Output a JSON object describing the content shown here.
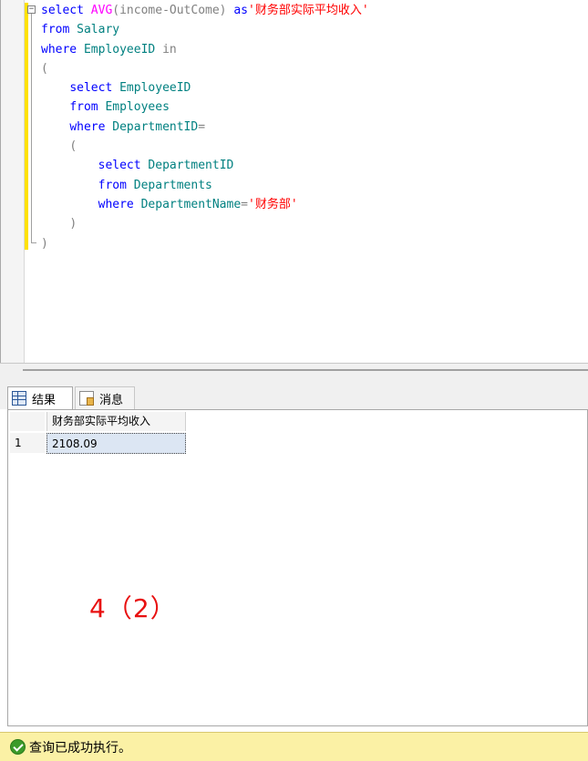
{
  "editor": {
    "line1": {
      "kw_select": "select",
      "fn_avg": "AVG",
      "args": "(income-OutCome)",
      "kw_as": "as",
      "alias": "'财务部实际平均收入'"
    },
    "line2": {
      "kw": "from",
      "ident": "Salary"
    },
    "line3": {
      "kw": "where",
      "ident": "EmployeeID",
      "kw_in": "in"
    },
    "line4": {
      "paren": "("
    },
    "line5": {
      "kw": "select",
      "ident": "EmployeeID"
    },
    "line6": {
      "kw": "from",
      "ident": "Employees"
    },
    "line7": {
      "kw": "where",
      "ident": "DepartmentID",
      "op": "="
    },
    "line8": {
      "paren": "("
    },
    "line9": {
      "kw": "select",
      "ident": "DepartmentID"
    },
    "line10": {
      "kw": "from",
      "ident": "Departments"
    },
    "line11": {
      "kw": "where",
      "ident": "DepartmentName",
      "op": "=",
      "str": "'财务部'"
    },
    "line12": {
      "paren": ")"
    },
    "line13": {
      "paren": ")"
    }
  },
  "tabs": {
    "results": "结果",
    "messages": "消息"
  },
  "grid": {
    "columns": [
      "财务部实际平均收入"
    ],
    "rows": [
      {
        "num": "1",
        "values": [
          "2108.09"
        ]
      }
    ]
  },
  "annotation": "4（2）",
  "status": {
    "text": "查询已成功执行。"
  },
  "colors": {
    "keyword": "#0000ff",
    "function": "#ff00ff",
    "string": "#ff0000",
    "identifier": "#008080",
    "operator": "#808080",
    "status_bg": "#fbf1a5",
    "annotation": "#e81010"
  }
}
